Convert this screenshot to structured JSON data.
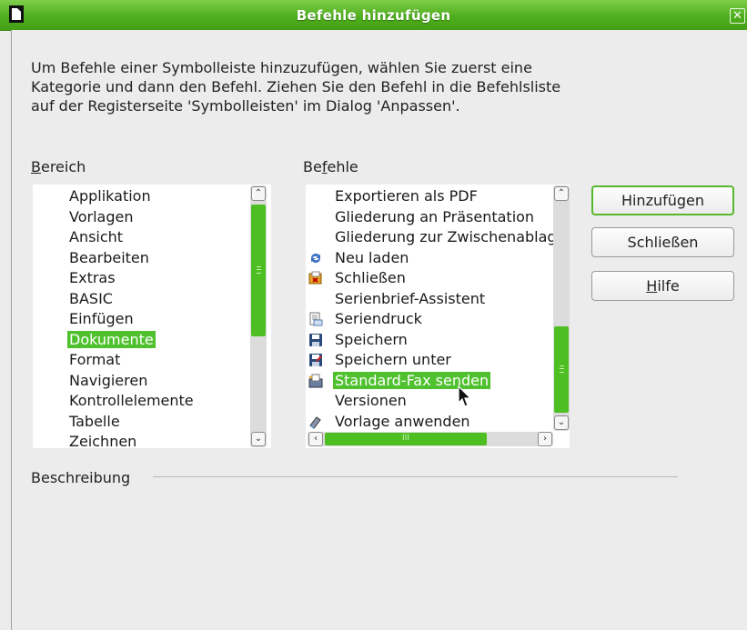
{
  "window": {
    "title": "Befehle hinzufügen",
    "close_glyph": "✕"
  },
  "description": "Um Befehle einer Symbolleiste hinzuzufügen, wählen Sie zuerst eine Kategorie und dann den Befehl. Ziehen Sie den Befehl in die Befehlsliste auf der Registerseite 'Symbolleisten' im Dialog 'Anpassen'.",
  "bereich": {
    "label_pre": "",
    "label_mnemonic": "B",
    "label_post": "ereich",
    "items": [
      "Applikation",
      "Vorlagen",
      "Ansicht",
      "Bearbeiten",
      "Extras",
      "BASIC",
      "Einfügen",
      "Dokumente",
      "Format",
      "Navigieren",
      "Kontrollelemente",
      "Tabelle",
      "Zeichnen"
    ],
    "selected": "Dokumente"
  },
  "befehle": {
    "label_pre": "Be",
    "label_mnemonic": "f",
    "label_post": "ehle",
    "items": [
      {
        "label": "Exportieren als PDF",
        "icon": ""
      },
      {
        "label": "Gliederung an Präsentation",
        "icon": ""
      },
      {
        "label": "Gliederung zur Zwischenablage",
        "icon": ""
      },
      {
        "label": "Neu laden",
        "icon": "reload-icon"
      },
      {
        "label": "Schließen",
        "icon": "close-doc-icon"
      },
      {
        "label": "Serienbrief-Assistent",
        "icon": ""
      },
      {
        "label": "Seriendruck",
        "icon": "mail-merge-icon"
      },
      {
        "label": "Speichern",
        "icon": "save-icon"
      },
      {
        "label": "Speichern unter",
        "icon": "save-as-icon"
      },
      {
        "label": "Standard-Fax senden",
        "icon": "fax-icon"
      },
      {
        "label": "Versionen",
        "icon": ""
      },
      {
        "label": "Vorlage anwenden",
        "icon": "apply-template-icon"
      }
    ],
    "selected": "Standard-Fax senden"
  },
  "buttons": {
    "add": "Hinzufügen",
    "close": "Schließen",
    "help_mnemonic": "H",
    "help_rest": "ilfe"
  },
  "beschreibung_label": "Beschreibung",
  "colors": {
    "accent": "#4fc12e",
    "titlebar": "#4fae1d"
  }
}
